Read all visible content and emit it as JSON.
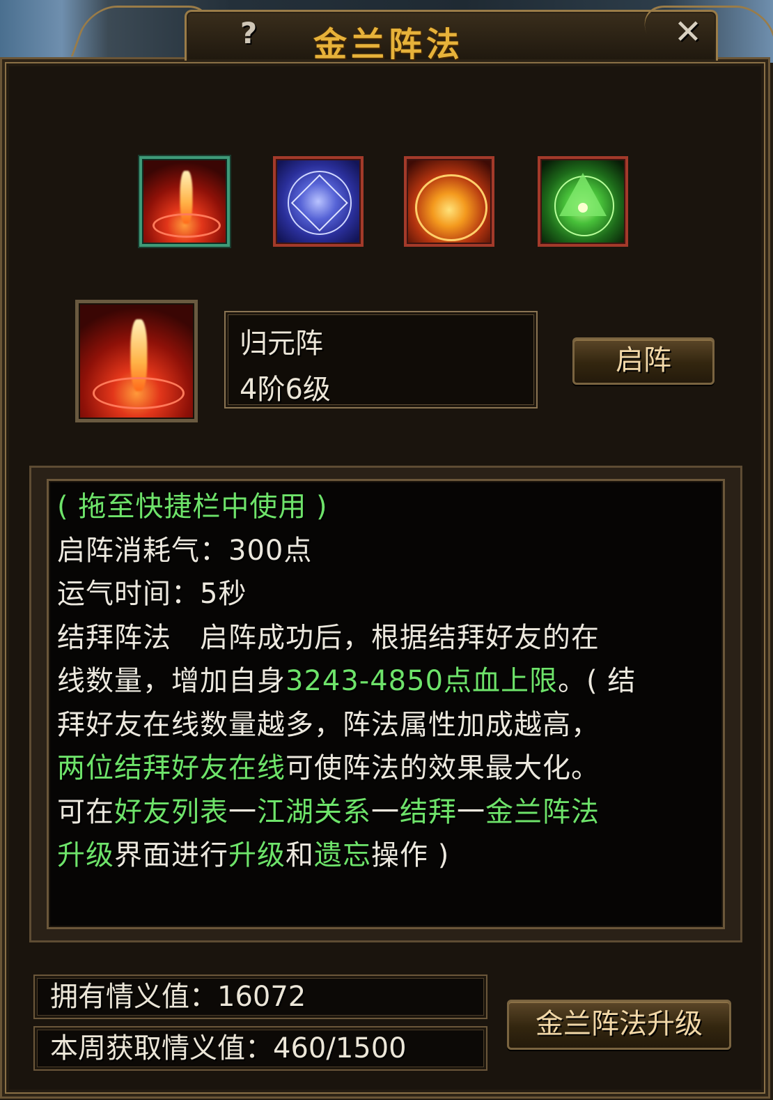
{
  "window": {
    "title": "金兰阵法",
    "help_label": "?",
    "close_label": "✕"
  },
  "formations": [
    {
      "name": "归元阵",
      "icon": "fire-pillar-icon",
      "selected": true
    },
    {
      "name": "",
      "icon": "star-web-icon",
      "selected": false
    },
    {
      "name": "",
      "icon": "sun-dome-icon",
      "selected": false
    },
    {
      "name": "",
      "icon": "triangle-eye-icon",
      "selected": false
    }
  ],
  "selected": {
    "name": "归元阵",
    "level": "4阶6级",
    "activate_label": "启阵"
  },
  "description": {
    "hint": "( 拖至快捷栏中使用 )",
    "cost": "启阵消耗气：300点",
    "time": "运气时间：5秒",
    "line1": "结拜阵法　启阵成功后，根据结拜好友的在",
    "line2_a": "线数量，增加自身",
    "line2_b": "3243-4850点血上限",
    "line2_c": "。( 结",
    "line3": "拜好友在线数量越多，阵法属性加成越高，",
    "line4_a": "两位结拜好友在线",
    "line4_b": "可使阵法的效果最大化。",
    "line5_a": "可在",
    "line5_b": "好友列表",
    "line5_c": "一",
    "line5_d": "江湖关系",
    "line5_e": "一",
    "line5_f": "结拜",
    "line5_g": "一",
    "line5_h": "金兰阵法",
    "line6_a": "升级",
    "line6_b": "界面进行",
    "line6_c": "升级",
    "line6_d": "和",
    "line6_e": "遗忘",
    "line6_f": "操作 )"
  },
  "footer": {
    "owned_label": "拥有情义值：16072",
    "week_label": "本周获取情义值：460/1500",
    "upgrade_label": "金兰阵法升级"
  },
  "colors": {
    "title": "#e7b23a",
    "highlight": "#6ee36a",
    "text": "#ece8de"
  }
}
